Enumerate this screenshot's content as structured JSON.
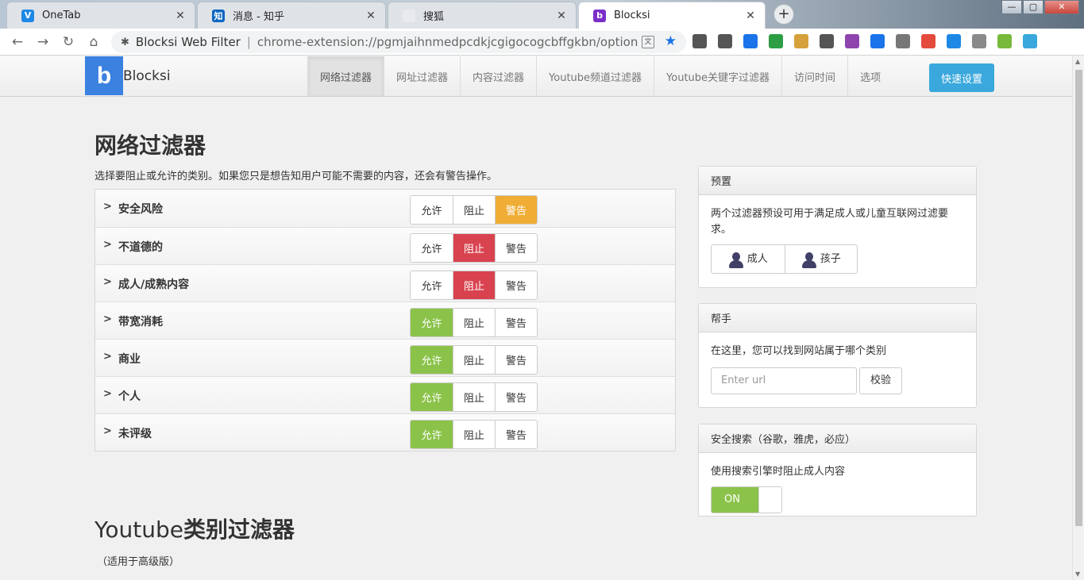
{
  "browser": {
    "tabs": [
      {
        "title": "OneTab",
        "favicon": "onetab-icon",
        "fav_char": "V",
        "fav_color": "#1e88e5",
        "active": false
      },
      {
        "title": "消息 - 知乎",
        "favicon": "zhihu-icon",
        "fav_char": "知",
        "fav_color": "#0a66c2",
        "active": false
      },
      {
        "title": "搜狐",
        "favicon": "sohu-icon",
        "fav_char": "",
        "fav_color": "#e8eaed",
        "active": false
      },
      {
        "title": "Blocksi",
        "favicon": "blocksi-icon",
        "fav_char": "b",
        "fav_color": "#7b2fc9",
        "active": true
      }
    ],
    "new_tab": "+",
    "window_buttons": {
      "minimize": "—",
      "maximize": "▢",
      "close": "✕"
    },
    "address": {
      "site_name": "Blocksi Web Filter",
      "url": "chrome-extension://pgmjaihnmedpcdkjcgigocogcbffgkbn/options.ht..."
    },
    "extension_colors": [
      "#555555",
      "#555555",
      "#1a73e8",
      "#2e9e44",
      "#d6a03a",
      "#555555",
      "#8e44ad",
      "#1a73e8",
      "#777777",
      "#e54b3c",
      "#1e88e5",
      "#8a8a8a",
      "#78b83b",
      "#3aa8dc"
    ]
  },
  "app": {
    "brand_letter": "b",
    "brand_name": "Blocksi",
    "nav": [
      "网络过滤器",
      "网址过滤器",
      "内容过滤器",
      "Youtube频道过滤器",
      "Youtube关键字过滤器",
      "访问时间",
      "选项"
    ],
    "active_nav": 0,
    "quick_setup": "快速设置",
    "accent": "#3aa8dc"
  },
  "main": {
    "title": "网络过滤器",
    "description": "选择要阻止或允许的类别。如果您只是想告知用户可能不需要的内容，还会有警告操作。",
    "option_labels": {
      "allow": "允许",
      "block": "阻止",
      "warn": "警告"
    },
    "categories": [
      {
        "name": "安全风险",
        "state": "warn"
      },
      {
        "name": "不道德的",
        "state": "block"
      },
      {
        "name": "成人/成熟内容",
        "state": "block"
      },
      {
        "name": "带宽消耗",
        "state": "allow"
      },
      {
        "name": "商业",
        "state": "allow"
      },
      {
        "name": "个人",
        "state": "allow"
      },
      {
        "name": "未评级",
        "state": "allow"
      }
    ],
    "youtube_title_latin": "Youtube",
    "youtube_title_cjk": "类别过滤器",
    "youtube_note": "（适用于高级版）",
    "colors": {
      "allow": "#8bc34a",
      "block": "#d9434f",
      "warn": "#f0ad35"
    }
  },
  "sidebar": {
    "presets": {
      "title": "预置",
      "text": "两个过滤器预设可用于满足成人或儿童互联网过滤要求。",
      "adult": "成人",
      "child": "孩子"
    },
    "helper": {
      "title": "帮手",
      "text": "在这里，您可以找到网站属于哪个类别",
      "placeholder": "Enter url",
      "check": "校验"
    },
    "safe_search": {
      "title": "安全搜索（谷歌，雅虎，必应）",
      "text": "使用搜索引擎时阻止成人内容",
      "toggle": "ON"
    }
  }
}
